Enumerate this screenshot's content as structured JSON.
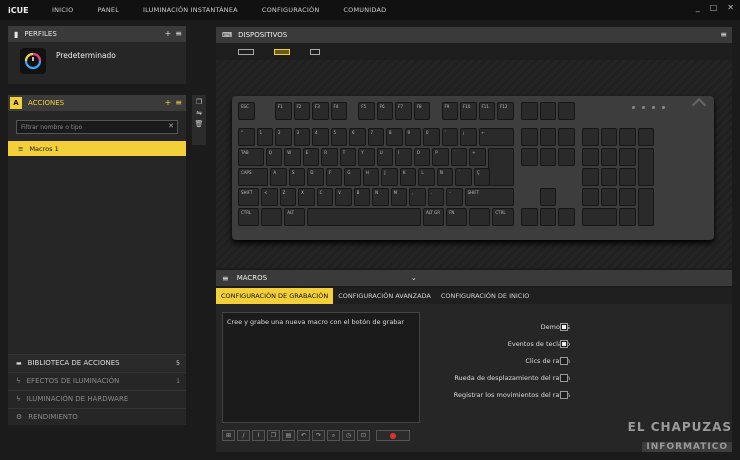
{
  "app": {
    "brand": "iCUE"
  },
  "nav": [
    "INICIO",
    "PANEL",
    "ILUMINACIÓN INSTANTÁNEA",
    "CONFIGURACIÓN",
    "COMUNIDAD"
  ],
  "window": {
    "minimize": "_",
    "maximize": "□",
    "close": "✕"
  },
  "profiles": {
    "title": "PERFILES",
    "add": "+",
    "menu": "≡",
    "profile_name": "Predeterminado"
  },
  "actions": {
    "badge": "A",
    "title": "ACCIONES",
    "add": "+",
    "menu": "≡",
    "filter_placeholder": "Filtrar nombre o tipo",
    "clear": "✕",
    "items": [
      "Macros 1"
    ]
  },
  "sections": [
    {
      "label": "BIBLIOTECA DE ACCIONES",
      "count": "5",
      "enabled": true
    },
    {
      "label": "EFECTOS DE ILUMINACIÓN",
      "count": "1",
      "enabled": false
    },
    {
      "label": "ILUMINACIÓN DE HARDWARE",
      "count": "",
      "enabled": false
    },
    {
      "label": "RENDIMIENTO",
      "count": "",
      "enabled": false
    }
  ],
  "devices": {
    "title": "DISPOSITIVOS",
    "menu": "≡"
  },
  "keyboard": {
    "row0": [
      "ESC",
      "F1",
      "F2",
      "F3",
      "F4",
      "F5",
      "F6",
      "F7",
      "F8",
      "F9",
      "F10",
      "F11",
      "F12"
    ],
    "row1": [
      "°",
      "1",
      "2",
      "3",
      "4",
      "5",
      "6",
      "7",
      "8",
      "9",
      "0",
      "'",
      "¡",
      "←"
    ],
    "row2": [
      "TAB",
      "Q",
      "W",
      "E",
      "R",
      "T",
      "Y",
      "U",
      "I",
      "O",
      "P",
      "`",
      "+"
    ],
    "row3": [
      "CAPS",
      "A",
      "S",
      "D",
      "F",
      "G",
      "H",
      "J",
      "K",
      "L",
      "Ñ",
      "´",
      "Ç",
      "ENTER"
    ],
    "row4": [
      "SHIFT",
      "<",
      "Z",
      "X",
      "C",
      "V",
      "B",
      "N",
      "M",
      ",",
      ".",
      "-",
      "SHIFT"
    ],
    "row5": [
      "CTRL",
      "",
      "ALT",
      "",
      "ALT GR",
      "FN",
      "",
      "CTRL"
    ]
  },
  "macros_bar": {
    "title": "MACROS",
    "chevron": "⌄"
  },
  "tabs": [
    "CONFIGURACIÓN DE GRABACIÓN",
    "CONFIGURACIÓN AVANZADA",
    "CONFIGURACIÓN DE INICIO"
  ],
  "record_hint": "Cree y grabe una nueva macro con el botón de grabar",
  "options": [
    {
      "label": "Demoras",
      "checked": true
    },
    {
      "label": "Eventos de teclado",
      "checked": true
    },
    {
      "label": "Clics de ratón",
      "checked": false
    },
    {
      "label": "Rueda de desplazamiento del ratón",
      "checked": false
    },
    {
      "label": "Registrar los movimientos del ratón",
      "checked": false
    }
  ],
  "watermark": {
    "line1": "EL CHAPUZAS",
    "line2": "INFORMATICO"
  }
}
